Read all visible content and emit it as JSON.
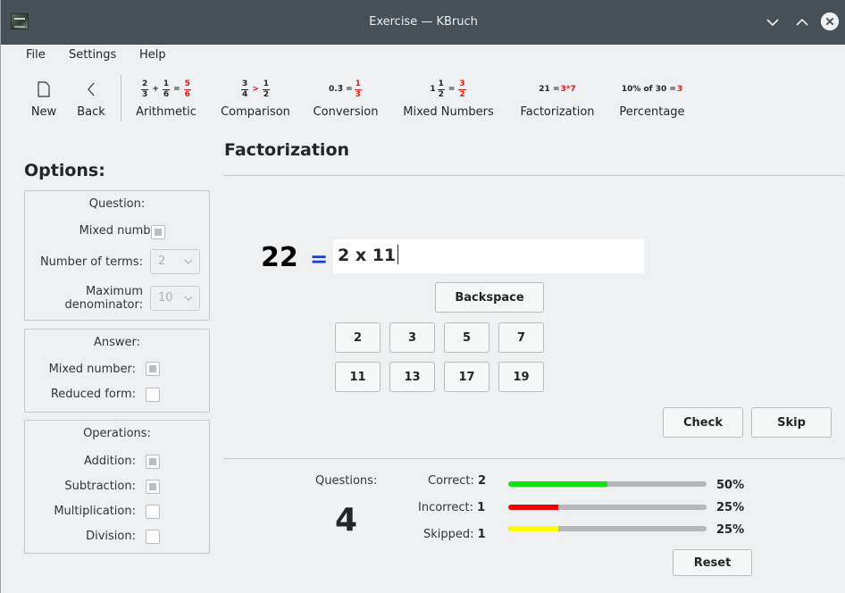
{
  "window": {
    "title": "Exercise — KBruch"
  },
  "menu": {
    "items": [
      "File",
      "Settings",
      "Help"
    ]
  },
  "toolbar": {
    "new_label": "New",
    "back_label": "Back",
    "arithmetic_label": "Arithmetic",
    "comparison_label": "Comparison",
    "conversion_label": "Conversion",
    "mixed_numbers_label": "Mixed Numbers",
    "factorization_label": "Factorization",
    "percentage_label": "Percentage",
    "arithmetic_icon": {
      "a_num": "2",
      "a_den": "3",
      "op": "+",
      "b_num": "1",
      "b_den": "6",
      "eq": "=",
      "r_num": "5",
      "r_den": "6"
    },
    "comparison_icon": {
      "a_num": "3",
      "a_den": "4",
      "op": ">",
      "b_num": "1",
      "b_den": "2"
    },
    "conversion_icon": {
      "left": "0.3̄ =",
      "r_num": "1",
      "r_den": "3"
    },
    "mixed_icon": {
      "whole": "1",
      "a_num": "1",
      "a_den": "2",
      "eq": "=",
      "r_num": "3",
      "r_den": "2"
    },
    "factorization_icon": {
      "left": "21 =",
      "right": "3*7"
    },
    "percentage_icon": {
      "left": "10% of 30 =",
      "right": "3"
    }
  },
  "options": {
    "title": "Options:",
    "question": {
      "title": "Question:",
      "mixed_number_label": "Mixed number:",
      "mixed_number_checked": true,
      "terms_label": "Number of terms:",
      "terms_value": "2",
      "max_denominator_label_1": "Maximum",
      "max_denominator_label_2": "denominator:",
      "max_denominator_value": "10"
    },
    "answer": {
      "title": "Answer:",
      "mixed_number_label": "Mixed number:",
      "mixed_number_checked": true,
      "reduced_form_label": "Reduced form:",
      "reduced_form_checked": false
    },
    "operations": {
      "title": "Operations:",
      "addition_label": "Addition:",
      "addition_checked": true,
      "subtraction_label": "Subtraction:",
      "subtraction_checked": true,
      "multiplication_label": "Multiplication:",
      "multiplication_checked": false,
      "division_label": "Division:",
      "division_checked": false
    }
  },
  "exercise": {
    "title": "Factorization",
    "number": "22",
    "equals": "=",
    "answer": "2 x 11",
    "backspace_label": "Backspace",
    "primes_row1": [
      "2",
      "3",
      "5",
      "7"
    ],
    "primes_row2": [
      "11",
      "13",
      "17",
      "19"
    ],
    "check_label": "Check",
    "skip_label": "Skip"
  },
  "stats": {
    "questions_label": "Questions:",
    "questions_count": "4",
    "correct_label": "Correct:",
    "correct_count": "2",
    "correct_pct": "50%",
    "correct_fraction": 0.5,
    "incorrect_label": "Incorrect:",
    "incorrect_count": "1",
    "incorrect_pct": "25%",
    "incorrect_fraction": 0.25,
    "skipped_label": "Skipped:",
    "skipped_count": "1",
    "skipped_pct": "25%",
    "skipped_fraction": 0.25,
    "reset_label": "Reset",
    "colors": {
      "correct": "#12e012",
      "incorrect": "#f00000",
      "skipped": "#ffff00"
    }
  }
}
